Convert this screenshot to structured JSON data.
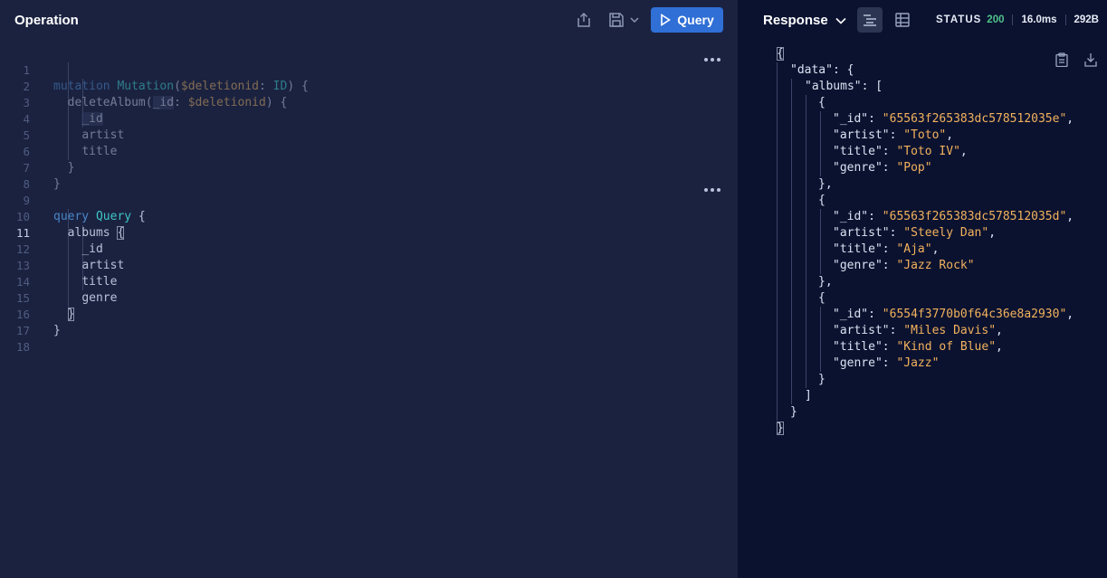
{
  "operation": {
    "title": "Operation",
    "run_label": "Query",
    "line_numbers": [
      "1",
      "2",
      "3",
      "4",
      "5",
      "6",
      "7",
      "8",
      "9",
      "10",
      "11",
      "12",
      "13",
      "14",
      "15",
      "16",
      "17",
      "18"
    ],
    "mutation": {
      "keyword": "mutation",
      "name": "Mutation",
      "var": "$deletionid",
      "type": "ID",
      "field": "deleteAlbum",
      "arg": "_id",
      "arg_var": "$deletionid",
      "selections": [
        "_id",
        "artist",
        "title"
      ]
    },
    "query": {
      "keyword": "query",
      "name": "Query",
      "field": "albums",
      "selections": [
        "_id",
        "artist",
        "title",
        "genre"
      ]
    }
  },
  "response": {
    "title": "Response",
    "status_label": "STATUS",
    "status_code": "200",
    "time": "16.0ms",
    "size": "292B",
    "data_key": "\"data\"",
    "albums_key": "\"albums\"",
    "albums": [
      {
        "_id": "\"65563f265383dc578512035e\"",
        "artist": "\"Toto\"",
        "title": "\"Toto IV\"",
        "genre": "\"Pop\""
      },
      {
        "_id": "\"65563f265383dc578512035d\"",
        "artist": "\"Steely Dan\"",
        "title": "\"Aja\"",
        "genre": "\"Jazz Rock\""
      },
      {
        "_id": "\"6554f3770b0f64c36e8a2930\"",
        "artist": "\"Miles Davis\"",
        "title": "\"Kind of Blue\"",
        "genre": "\"Jazz\""
      }
    ],
    "keys": {
      "id": "\"_id\"",
      "artist": "\"artist\"",
      "title": "\"title\"",
      "genre": "\"genre\""
    }
  },
  "icons": {
    "share": "share-icon",
    "save": "save-icon",
    "chevron": "chevron-down-icon",
    "play": "play-icon",
    "more": "more-icon",
    "text_view": "text-view-icon",
    "table_view": "table-view-icon",
    "copy": "clipboard-icon",
    "download": "download-icon"
  },
  "colors": {
    "run_button": "#2f6fd6",
    "status_ok": "#4fc28a",
    "string": "#f2b25c",
    "keyword": "#4a86c8",
    "name": "#3ec5c5"
  }
}
